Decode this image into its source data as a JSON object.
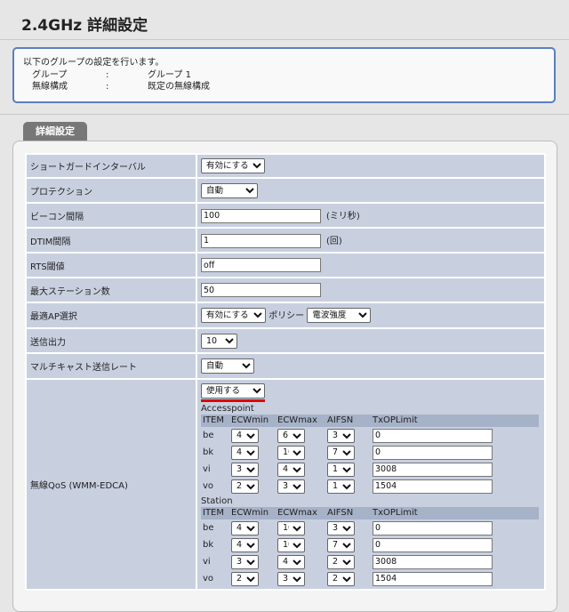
{
  "page": {
    "title": "2.4GHz 詳細設定"
  },
  "info": {
    "description": "以下のグループの設定を行います。",
    "rows": [
      {
        "key": "グループ",
        "colon": ":",
        "value": "グループ 1"
      },
      {
        "key": "無線構成",
        "colon": ":",
        "value": "既定の無線構成"
      }
    ]
  },
  "tab": {
    "label": "詳細設定"
  },
  "settings": {
    "short_guard": {
      "label": "ショートガードインターバル",
      "value": "有効にする"
    },
    "protection": {
      "label": "プロテクション",
      "value": "自動"
    },
    "beacon": {
      "label": "ビーコン間隔",
      "value": "100",
      "unit": "(ミリ秒)"
    },
    "dtim": {
      "label": "DTIM間隔",
      "value": "1",
      "unit": "(回)"
    },
    "rts": {
      "label": "RTS閾値",
      "value": "off"
    },
    "max_station": {
      "label": "最大ステーション数",
      "value": "50"
    },
    "best_ap": {
      "label": "最適AP選択",
      "value": "有効にする",
      "policy_label": "ポリシー",
      "policy_value": "電波強度"
    },
    "tx_power": {
      "label": "送信出力",
      "value": "10"
    },
    "multicast": {
      "label": "マルチキャスト送信レート",
      "value": "自動"
    },
    "qos": {
      "label": "無線QoS (WMM-EDCA)",
      "value": "使用する",
      "columns": [
        "ITEM",
        "ECWmin",
        "ECWmax",
        "AIFSN",
        "TxOPLimit"
      ],
      "accesspoint_title": "Accesspoint",
      "accesspoint": [
        {
          "item": "be",
          "ecwmin": "4",
          "ecwmax": "6",
          "aifsn": "3",
          "txop": "0"
        },
        {
          "item": "bk",
          "ecwmin": "4",
          "ecwmax": "10",
          "aifsn": "7",
          "txop": "0"
        },
        {
          "item": "vi",
          "ecwmin": "3",
          "ecwmax": "4",
          "aifsn": "1",
          "txop": "3008"
        },
        {
          "item": "vo",
          "ecwmin": "2",
          "ecwmax": "3",
          "aifsn": "1",
          "txop": "1504"
        }
      ],
      "station_title": "Station",
      "station": [
        {
          "item": "be",
          "ecwmin": "4",
          "ecwmax": "10",
          "aifsn": "3",
          "txop": "0"
        },
        {
          "item": "bk",
          "ecwmin": "4",
          "ecwmax": "10",
          "aifsn": "7",
          "txop": "0"
        },
        {
          "item": "vi",
          "ecwmin": "3",
          "ecwmax": "4",
          "aifsn": "2",
          "txop": "3008"
        },
        {
          "item": "vo",
          "ecwmin": "2",
          "ecwmax": "3",
          "aifsn": "2",
          "txop": "1504"
        }
      ]
    }
  },
  "colors": {
    "accent_border": "#5b7fbd",
    "row_bg": "#c8d0e0",
    "header_bg": "#a6b2c8",
    "tab_bg": "#777777",
    "highlight": "#e00000"
  }
}
